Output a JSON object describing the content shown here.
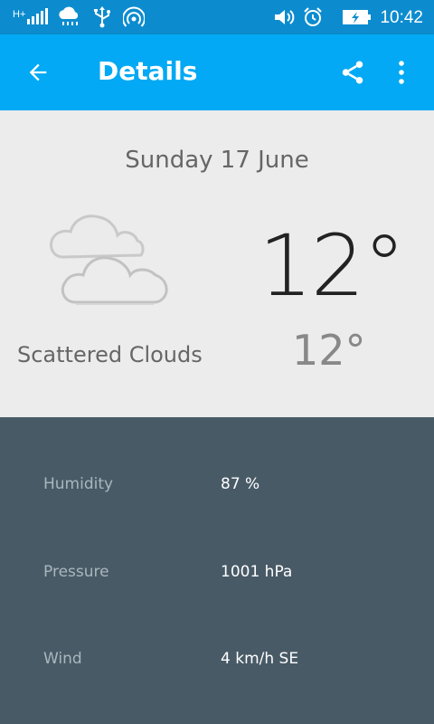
{
  "status_bar": {
    "signal_label": "H+",
    "time": "10:42",
    "icons": [
      "signal-icon",
      "weather-rain-icon",
      "usb-icon",
      "hotspot-icon",
      "volume-icon",
      "alarm-icon",
      "battery-charging-icon"
    ]
  },
  "app_bar": {
    "title": "Details",
    "back_icon": "arrow-back-icon",
    "share_icon": "share-icon",
    "overflow_icon": "more-vert-icon"
  },
  "forecast": {
    "date": "Sunday 17 June",
    "condition": "Scattered Clouds",
    "condition_icon": "scattered-clouds-icon",
    "high": "12°",
    "low": "12°"
  },
  "details": [
    {
      "label": "Humidity",
      "value": "87 %"
    },
    {
      "label": "Pressure",
      "value": "1001 hPa"
    },
    {
      "label": "Wind",
      "value": "4 km/h SE"
    }
  ],
  "colors": {
    "status_bar": "#0c8ccf",
    "app_bar": "#03a9f4",
    "hero_bg": "#ececec",
    "details_bg": "#485a66"
  }
}
